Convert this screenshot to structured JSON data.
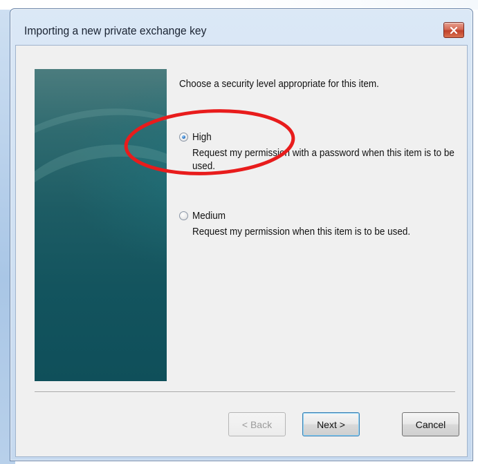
{
  "dialog": {
    "title": "Importing a new private exchange key",
    "prompt": "Choose a security level appropriate for this item."
  },
  "options": [
    {
      "label": "High",
      "description": "Request my permission with a password when this item is to be used.",
      "selected": true
    },
    {
      "label": "Medium",
      "description": "Request my permission when this item is to be used.",
      "selected": false
    }
  ],
  "buttons": {
    "back": "< Back",
    "next": "Next >",
    "cancel": "Cancel",
    "back_enabled": false
  },
  "icons": {
    "close": "close-icon"
  },
  "colors": {
    "annotation": "#e81c1c",
    "side_panel": "#1d5c64"
  }
}
